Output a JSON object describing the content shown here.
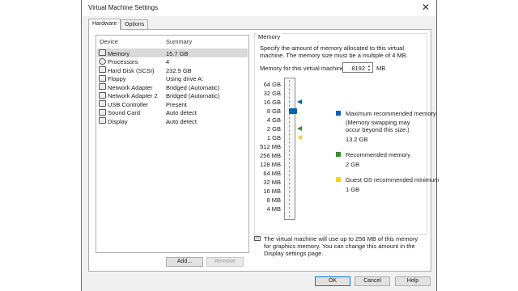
{
  "window": {
    "title": "Virtual Machine Settings"
  },
  "tabs": [
    {
      "label": "Hardware"
    },
    {
      "label": "Options"
    }
  ],
  "devices": {
    "header_device": "Device",
    "header_summary": "Summary",
    "items": [
      {
        "name": "Memory",
        "summary": "15.7 GB",
        "icon": "memory-icon"
      },
      {
        "name": "Processors",
        "summary": "4",
        "icon": "processor-icon"
      },
      {
        "name": "Hard Disk (SCSI)",
        "summary": "232.9 GB",
        "icon": "hard-disk-icon"
      },
      {
        "name": "Floppy",
        "summary": "Using drive A:",
        "icon": "floppy-icon"
      },
      {
        "name": "Network Adapter",
        "summary": "Bridged (Automatic)",
        "icon": "network-adapter-icon"
      },
      {
        "name": "Network Adapter 2",
        "summary": "Bridged (Automatic)",
        "icon": "network-adapter-icon"
      },
      {
        "name": "USB Controller",
        "summary": "Present",
        "icon": "usb-icon"
      },
      {
        "name": "Sound Card",
        "summary": "Auto detect",
        "icon": "sound-card-icon"
      },
      {
        "name": "Display",
        "summary": "Auto detect",
        "icon": "display-icon"
      }
    ],
    "add_label": "Add...",
    "remove_label": "Remove"
  },
  "memory": {
    "group_title": "Memory",
    "description": "Specify the amount of memory allocated to this virtual machine. The memory size must be a multiple of 4 MB.",
    "input_label": "Memory for this virtual machine:",
    "value": "8192",
    "unit": "MB",
    "scale": [
      "64 GB",
      "32 GB",
      "16 GB",
      "8 GB",
      "4 GB",
      "2 GB",
      "1 GB",
      "512 MB",
      "256 MB",
      "128 MB",
      "64 MB",
      "32 MB",
      "16 MB",
      "8 MB",
      "4 MB"
    ],
    "legend": {
      "max_title": "Maximum recommended memory",
      "max_note": "(Memory swapping may occur beyond this size.)",
      "max_value": "13.2 GB",
      "rec_title": "Recommended memory",
      "rec_value": "2 GB",
      "guest_title": "Guest OS recommended minimum",
      "guest_value": "1 GB"
    },
    "colors": {
      "max": "#0063b1",
      "recommended": "#3c8d2f",
      "guest_min": "#f2d21b"
    },
    "graphics_note": "The virtual machine will use up to 256 MB of this memory for graphics memory. You can change this amount in the Display settings page."
  },
  "footer": {
    "ok": "OK",
    "cancel": "Cancel",
    "help": "Help"
  }
}
